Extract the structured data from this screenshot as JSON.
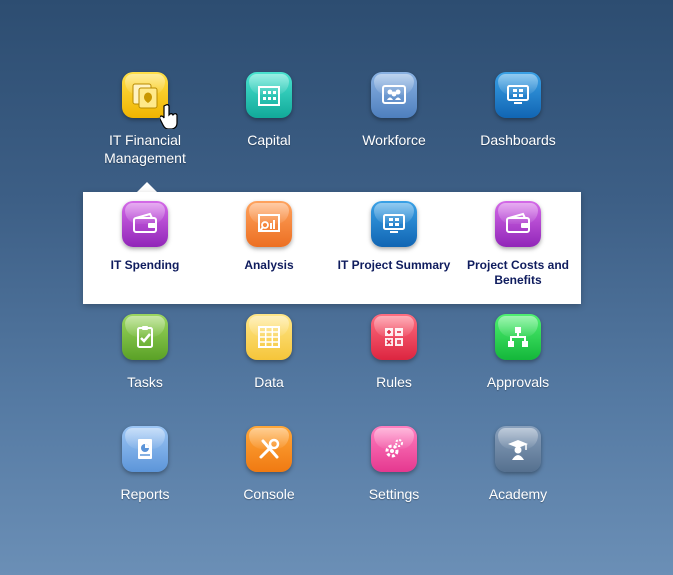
{
  "main_tiles": [
    {
      "label": "IT Financial Management",
      "icon": "money-bag-icon",
      "color": "#f5c518"
    },
    {
      "label": "Capital",
      "icon": "building-icon",
      "color": "#1fc7b4"
    },
    {
      "label": "Workforce",
      "icon": "people-icon",
      "color": "#6d9bd4"
    },
    {
      "label": "Dashboards",
      "icon": "monitor-icon",
      "color": "#1c7fd0"
    },
    {
      "label": "Tasks",
      "icon": "clipboard-check-icon",
      "color": "#7bc043"
    },
    {
      "label": "Data",
      "icon": "grid-icon",
      "color": "#f7d55c"
    },
    {
      "label": "Rules",
      "icon": "calculator-icon",
      "color": "#ee3a55"
    },
    {
      "label": "Approvals",
      "icon": "flowchart-icon",
      "color": "#28d150"
    },
    {
      "label": "Reports",
      "icon": "report-icon",
      "color": "#7eb0ea"
    },
    {
      "label": "Console",
      "icon": "tools-icon",
      "color": "#f58a1f"
    },
    {
      "label": "Settings",
      "icon": "gears-icon",
      "color": "#f05aa8"
    },
    {
      "label": "Academy",
      "icon": "graduate-icon",
      "color": "#6f88a8"
    }
  ],
  "submenu": {
    "items": [
      {
        "label": "IT Spending",
        "icon": "wallet-icon",
        "color": "#b042d0"
      },
      {
        "label": "Analysis",
        "icon": "chart-icon",
        "color": "#f5884a"
      },
      {
        "label": "IT Project Summary",
        "icon": "monitor-icon",
        "color": "#1c7fd0"
      },
      {
        "label": "Project Costs and Benefits",
        "icon": "wallet-icon",
        "color": "#b042d0"
      }
    ]
  }
}
